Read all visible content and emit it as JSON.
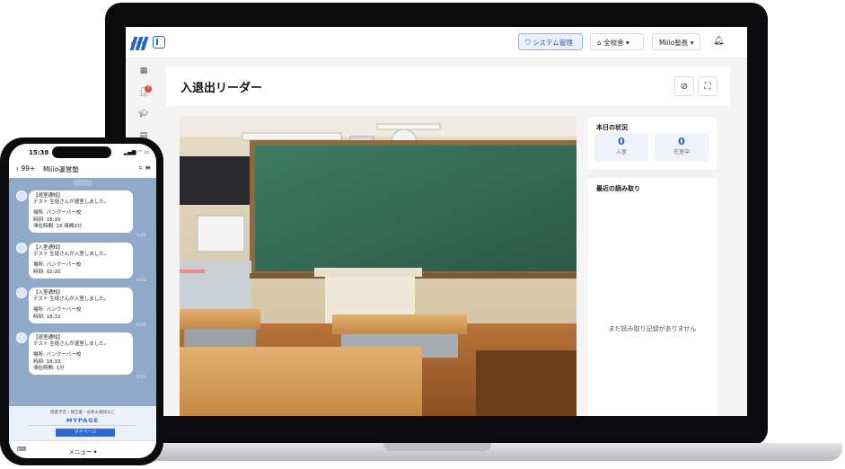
{
  "laptop": {
    "topbar": {
      "system_admin": "システム管理",
      "campus_select": "全校舎",
      "user_menu": "Miiio塾長"
    },
    "sidebar": {
      "notification_badge": "7",
      "icons": [
        "grid-icon",
        "users-icon",
        "graduation-cap-icon",
        "building-icon"
      ]
    },
    "page": {
      "title": "入退出リーダー"
    },
    "status_card": {
      "title": "本日の状況",
      "entered_count": "0",
      "entered_label": "入室",
      "present_count": "0",
      "present_label": "在室中"
    },
    "recent_card": {
      "title": "最近の読み取り",
      "empty_message": "まだ読み取り記録がありません"
    }
  },
  "phone": {
    "status_bar": {
      "time": "15:38"
    },
    "chat_header": {
      "back_label": "99+",
      "channel_name": "Miiio運営塾"
    },
    "messages": [
      {
        "line1": "【退室通知】",
        "line2": "テスト 生徒さんが退室しました。",
        "line3": "場所: バンクーバー校",
        "line4": "時刻: 18:20",
        "line5": "滞在時間: 16 時間2分",
        "time": "0:25"
      },
      {
        "line1": "【入室通知】",
        "line2": "テスト 生徒さんが入室しました。",
        "line3": "場所: バンクーバー校",
        "line4": "時刻: 02:20",
        "time": "0:25"
      },
      {
        "line1": "【入室通知】",
        "line2": "テスト 生徒さんが入室しました。",
        "line3": "場所: バンクーバー校",
        "line4": "時刻: 18:32",
        "time": "0:25"
      },
      {
        "line1": "【退室通知】",
        "line2": "テスト 生徒さんが退室しました。",
        "line3": "場所: バンクーバー校",
        "line4": "時刻: 18:33",
        "line5": "滞在時間: 1分",
        "time": "0:25"
      }
    ],
    "promo": {
      "caption": "授業予定・報告書・お休み連絡など",
      "title": "MYPAGE",
      "button_label": "マイページ"
    },
    "menu_bar": {
      "menu_label": "メニュー ▾"
    }
  },
  "colors": {
    "accent": "#1d63d8",
    "badge": "#e24a3b",
    "chat_background": "#8fa9c8"
  }
}
